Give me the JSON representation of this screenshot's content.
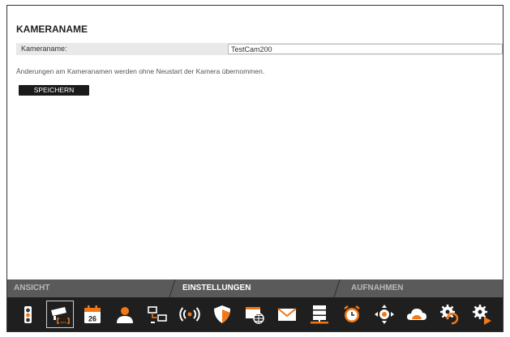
{
  "page": {
    "section_title": "KAMERANAME",
    "field_label": "Kameraname:",
    "field_value": "TestCam200",
    "hint": "Änderungen am Kameranamen werden ohne Neustart der Kamera übernommen.",
    "save_label": "SPEICHERN"
  },
  "tabs": [
    {
      "label": "ANSICHT",
      "active": false
    },
    {
      "label": "EINSTELLUNGEN",
      "active": true
    },
    {
      "label": "AUFNAHMEN",
      "active": false
    }
  ],
  "calendar_day": "26",
  "toolbar_icons": [
    {
      "icon": "traffic-light-icon"
    },
    {
      "icon": "camera-name-icon",
      "active": true
    },
    {
      "icon": "calendar-icon"
    },
    {
      "icon": "user-icon"
    },
    {
      "icon": "network-icon"
    },
    {
      "icon": "wireless-icon"
    },
    {
      "icon": "shield-icon"
    },
    {
      "icon": "web-icon"
    },
    {
      "icon": "mail-icon"
    },
    {
      "icon": "server-icon"
    },
    {
      "icon": "alarm-clock-icon"
    },
    {
      "icon": "ptz-icon"
    },
    {
      "icon": "cloud-icon"
    },
    {
      "icon": "settings-restore-icon"
    },
    {
      "icon": "settings-play-icon"
    }
  ],
  "colors": {
    "accent": "#f07818",
    "icon_bar": "#1f1f1f",
    "tab_bar": "#5a5a5a"
  }
}
